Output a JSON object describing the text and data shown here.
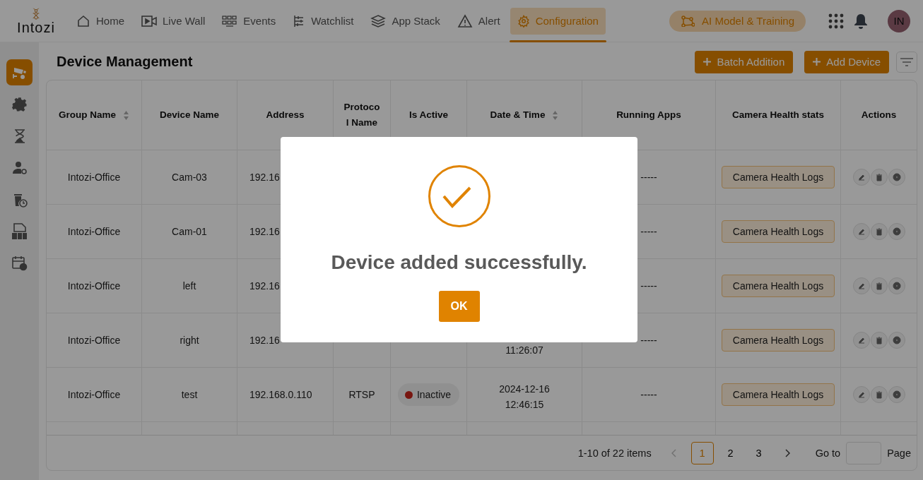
{
  "nav": {
    "logo": "Intozi",
    "items": [
      {
        "label": "Home",
        "selected": false
      },
      {
        "label": "Live Wall",
        "selected": false
      },
      {
        "label": "Events",
        "selected": false
      },
      {
        "label": "Watchlist",
        "selected": false
      },
      {
        "label": "App Stack",
        "selected": false
      },
      {
        "label": "Alert",
        "selected": false
      },
      {
        "label": "Configuration",
        "selected": true
      }
    ],
    "ai_button": "AI Model & Training",
    "avatar": "IN"
  },
  "sidebar": {
    "items": [
      {
        "selected": true
      },
      {
        "selected": false
      },
      {
        "selected": false
      },
      {
        "selected": false
      },
      {
        "selected": false
      },
      {
        "selected": false
      },
      {
        "selected": false
      }
    ]
  },
  "page": {
    "title": "Device Management",
    "buttons": [
      "Batch Addition",
      "Add Device"
    ]
  },
  "table": {
    "columns": [
      {
        "label": "Group Name",
        "sortable": true
      },
      {
        "label": "Device Name",
        "sortable": false
      },
      {
        "label": "Address",
        "sortable": false
      },
      {
        "label": "Protocol Name",
        "sortable": false
      },
      {
        "label": "Is Active",
        "sortable": false
      },
      {
        "label": "Date & Time",
        "sortable": true
      },
      {
        "label": "Running Apps",
        "sortable": false
      },
      {
        "label": "Camera Health stats",
        "sortable": false
      },
      {
        "label": "Actions",
        "sortable": false
      }
    ],
    "rows": [
      {
        "group": "Intozi-Office",
        "device": "Cam-03",
        "address": "192.16",
        "running_apps": "-----",
        "health": "Camera Health Logs"
      },
      {
        "group": "Intozi-Office",
        "device": "Cam-01",
        "address": "192.16",
        "running_apps": "-----",
        "health": "Camera Health Logs"
      },
      {
        "group": "Intozi-Office",
        "device": "left",
        "address": "192.16",
        "running_apps": "-----",
        "health": "Camera Health Logs"
      },
      {
        "group": "Intozi-Office",
        "device": "right",
        "address": "192.16",
        "date_time": [
          "11:26:07"
        ],
        "running_apps": "-----",
        "health": "Camera Health Logs"
      },
      {
        "group": "Intozi-Office",
        "device": "test",
        "address": "192.168.0.110",
        "protocol": "RTSP",
        "status": {
          "label": "Inactive",
          "active": false
        },
        "date_time": [
          "2024-12-16",
          "12:46:15"
        ],
        "running_apps": "-----",
        "health": "Camera Health Logs"
      }
    ]
  },
  "pagination": {
    "summary": "1-10 of 22 items",
    "pages": [
      {
        "label": "1",
        "selected": true
      },
      {
        "label": "2",
        "selected": false
      },
      {
        "label": "3",
        "selected": false
      }
    ],
    "goto_label": "Go to",
    "page_label": "Page"
  },
  "dialog": {
    "message": "Device added successfully.",
    "button": "OK"
  }
}
